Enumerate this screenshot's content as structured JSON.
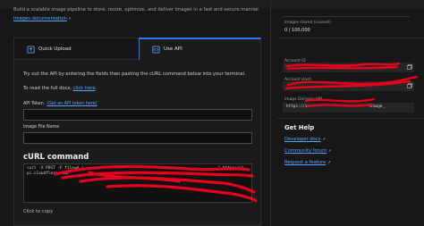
{
  "intro": {
    "description": "Build a scalable image pipeline to store, resize, optimize, and deliver images in a fast and secure manner.",
    "docs_link": "Images documentation"
  },
  "tabs": [
    {
      "label": "Quick Upload",
      "icon": "upload-icon",
      "active": false
    },
    {
      "label": "Use API",
      "icon": "code-icon",
      "active": true
    }
  ],
  "api": {
    "instruction": "Try out the API by entering the fields then pasting the cURL command below into your terminal.",
    "docs_prefix": "To read the full docs,",
    "docs_link": "click here",
    "docs_suffix": ".",
    "token_label": "API Token",
    "token_link": "(Get an API token here)",
    "token_value": "",
    "file_label": "Image File Name",
    "file_value": "",
    "curl_heading": "cURL command",
    "curl_line1": "curl -X POST -F file=@./",
    "curl_line1_tail": "\" https://a",
    "curl_line2": "pi.cloudflare.com/",
    "click_to_copy": "Click to copy"
  },
  "sidebar": {
    "images_stored_label": "Images stored (current)",
    "images_stored_value": "0 / 100,000",
    "images_stored_fraction": 0,
    "account_id_label": "Account ID",
    "account_hash_label": "Account Hash",
    "delivery_url_label": "Image Delivery URL",
    "delivery_url": "https://im",
    "delivery_url_tail": "<image_",
    "get_help": "Get Help",
    "help_links": [
      "Developer docs",
      "Community forum",
      "Request a feature"
    ]
  },
  "colors": {
    "accent": "#2f7bf6",
    "link": "#5aa2ff",
    "redaction": "#e6001e"
  }
}
